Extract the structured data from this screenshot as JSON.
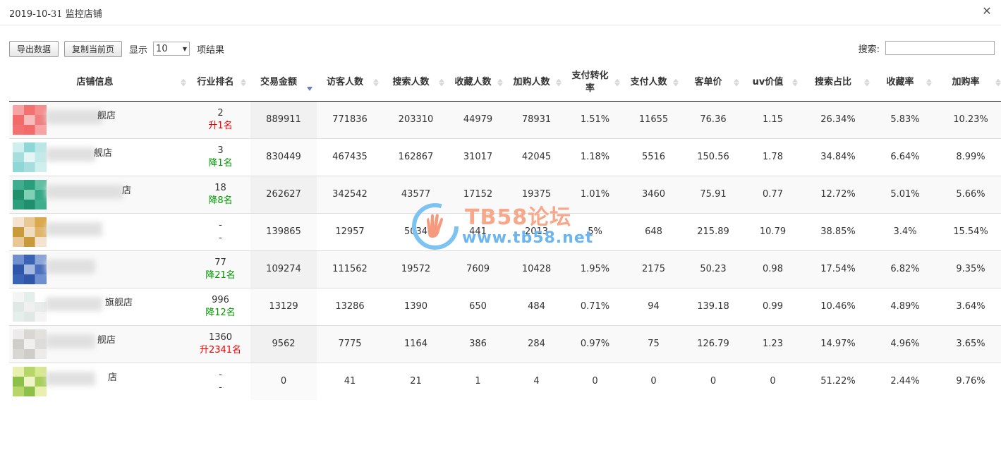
{
  "dialog": {
    "title_prefix": "2019-10-",
    "title_day": "31",
    "title_suffix": " 监控店铺",
    "close_glyph": "✕"
  },
  "toolbar": {
    "export_label": "导出数据",
    "copy_label": "复制当前页",
    "show_label": "显示",
    "page_size": "10",
    "results_label": "项结果"
  },
  "search": {
    "label": "搜索:",
    "value": ""
  },
  "table": {
    "headers": [
      "店铺信息",
      "行业排名",
      "交易金额",
      "访客人数",
      "搜索人数",
      "收藏人数",
      "加购人数",
      "支付转化率",
      "支付人数",
      "客单价",
      "uv价值",
      "搜索占比",
      "收藏率",
      "加购率"
    ],
    "rows": [
      {
        "shop_tail": "舰店",
        "thumb": [
          "#f7a3a3",
          "#f47171",
          "#f58e8e",
          "#f26a6a",
          "#f9bcbc",
          "#f08080"
        ],
        "rank": "2",
        "change": "升1名",
        "change_dir": "up",
        "amount": "889911",
        "visitors": "771836",
        "searchers": "203310",
        "favs": "44979",
        "carts": "78931",
        "conv": "1.51%",
        "payers": "11655",
        "aov": "76.36",
        "uv": "1.15",
        "search_share": "26.34%",
        "fav_rate": "5.83%",
        "cart_rate": "10.23%"
      },
      {
        "shop_tail": "舰店",
        "thumb": [
          "#cfeeee",
          "#8fd7d7",
          "#b9e6e6",
          "#a6dede",
          "#e3f5f5",
          "#c2eaea"
        ],
        "rank": "3",
        "change": "降1名",
        "change_dir": "down",
        "amount": "830449",
        "visitors": "467435",
        "searchers": "162867",
        "favs": "31017",
        "carts": "42045",
        "conv": "1.18%",
        "payers": "5516",
        "aov": "150.56",
        "uv": "1.78",
        "search_share": "34.84%",
        "fav_rate": "6.64%",
        "cart_rate": "8.99%"
      },
      {
        "shop_tail": "店",
        "thumb": [
          "#3fae8e",
          "#2a9d7a",
          "#5fc0a2",
          "#1f8f6c",
          "#7fd0b5",
          "#36a887"
        ],
        "rank": "18",
        "change": "降8名",
        "change_dir": "down",
        "amount": "262627",
        "visitors": "342542",
        "searchers": "43577",
        "favs": "17152",
        "carts": "19375",
        "conv": "1.01%",
        "payers": "3460",
        "aov": "75.91",
        "uv": "0.77",
        "search_share": "12.72%",
        "fav_rate": "5.01%",
        "cart_rate": "5.66%"
      },
      {
        "shop_tail": "",
        "thumb": [
          "#f3e3cf",
          "#e8c894",
          "#d9a94a",
          "#c99a3c",
          "#f0dcc0",
          "#e0b56a"
        ],
        "rank": "-",
        "change": "-",
        "change_dir": "none",
        "amount": "139865",
        "visitors": "12957",
        "searchers": "5034",
        "favs": "441",
        "carts": "2013",
        "conv": "5%",
        "payers": "648",
        "aov": "215.89",
        "uv": "10.79",
        "search_share": "38.85%",
        "fav_rate": "3.4%",
        "cart_rate": "15.54%"
      },
      {
        "shop_tail": "",
        "thumb": [
          "#6f8fcf",
          "#3a62b5",
          "#8aa4d8",
          "#2f56a8",
          "#a5b8e0",
          "#4a70bd"
        ],
        "rank": "77",
        "change": "降21名",
        "change_dir": "down",
        "amount": "109274",
        "visitors": "111562",
        "searchers": "19572",
        "favs": "7609",
        "carts": "10428",
        "conv": "1.95%",
        "payers": "2175",
        "aov": "50.23",
        "uv": "0.98",
        "search_share": "17.54%",
        "fav_rate": "6.82%",
        "cart_rate": "9.35%"
      },
      {
        "shop_tail": "旗舰店",
        "thumb": [
          "#f4f4f4",
          "#e4eeea",
          "#ffffff",
          "#dfe8e4",
          "#f0f0f0",
          "#e8ecea"
        ],
        "rank": "996",
        "change": "降12名",
        "change_dir": "down",
        "amount": "13129",
        "visitors": "13286",
        "searchers": "1390",
        "favs": "650",
        "carts": "484",
        "conv": "0.71%",
        "payers": "94",
        "aov": "139.18",
        "uv": "0.99",
        "search_share": "10.46%",
        "fav_rate": "4.89%",
        "cart_rate": "3.64%"
      },
      {
        "shop_tail": "舰店",
        "thumb": [
          "#ecebea",
          "#d9d7d4",
          "#e3e1de",
          "#cfcdca",
          "#f1f0ef",
          "#dedcd9"
        ],
        "rank": "1360",
        "change": "升2341名",
        "change_dir": "up",
        "amount": "9562",
        "visitors": "7775",
        "searchers": "1164",
        "favs": "386",
        "carts": "284",
        "conv": "0.97%",
        "payers": "75",
        "aov": "126.79",
        "uv": "1.23",
        "search_share": "14.97%",
        "fav_rate": "4.96%",
        "cart_rate": "3.65%"
      },
      {
        "shop_tail": "店",
        "thumb": [
          "#e8f0b0",
          "#b7d66a",
          "#d6e890",
          "#8cc04a",
          "#f0f5c8",
          "#a8cf5c"
        ],
        "rank": "-",
        "change": "-",
        "change_dir": "none",
        "amount": "0",
        "visitors": "41",
        "searchers": "21",
        "favs": "1",
        "carts": "4",
        "conv": "0",
        "payers": "0",
        "aov": "0",
        "uv": "0",
        "search_share": "51.22%",
        "fav_rate": "2.44%",
        "cart_rate": "9.76%"
      }
    ]
  },
  "watermark": {
    "brand": "TB58论坛",
    "url": "www.tb58.net"
  }
}
